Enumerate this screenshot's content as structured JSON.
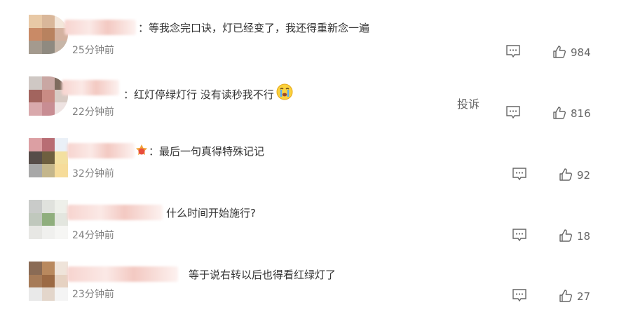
{
  "comments": [
    {
      "text": "：等我念完口诀，灯已经变了，我还得重新念一遍",
      "time": "25分钟前",
      "likes": "984",
      "report": ""
    },
    {
      "text": "：红灯停绿灯行 没有读秒我不行",
      "time": "22分钟前",
      "likes": "816",
      "report": "投诉"
    },
    {
      "text": "：最后一句真得特殊记记",
      "time": "32分钟前",
      "likes": "92",
      "report": ""
    },
    {
      "text": "什么时间开始施行?",
      "time": "24分钟前",
      "likes": "18",
      "report": ""
    },
    {
      "text": "等于说右转以后也得看红绿灯了",
      "time": "23分钟前",
      "likes": "27",
      "report": ""
    }
  ],
  "icons": {
    "reply": "comment-icon",
    "like": "thumbs-up-icon",
    "emoji_crying": "crying-emoji",
    "emoji_badge": "fan-badge-icon"
  }
}
